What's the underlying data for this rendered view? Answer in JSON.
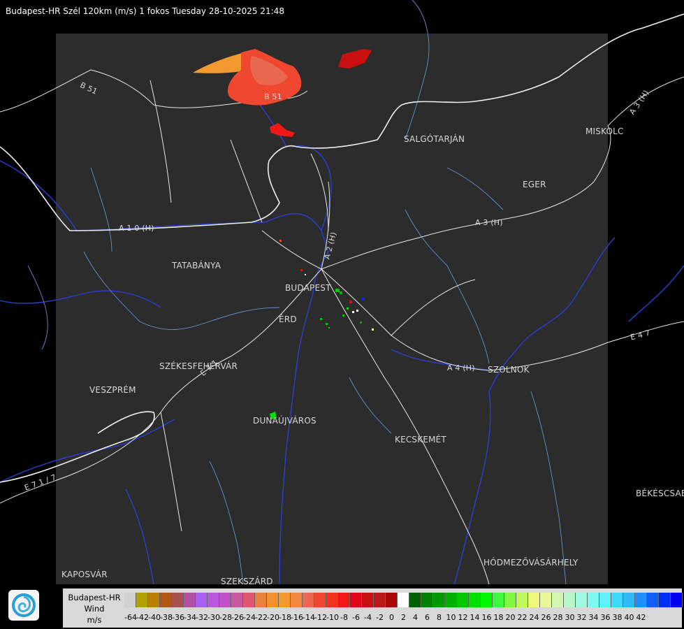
{
  "title": "Budapest-HR Szél 120km (m/s) 1 fokos Tuesday 28-10-2025 21:48",
  "cities": [
    {
      "name": "SALGÓTARJÁN"
    },
    {
      "name": "MISKOLC"
    },
    {
      "name": "EGER"
    },
    {
      "name": "TATABÁNYA"
    },
    {
      "name": "BUDAPEST"
    },
    {
      "name": "ÉRD"
    },
    {
      "name": "SZÉKESFEHÉRVÁR"
    },
    {
      "name": "VESZPRÉM"
    },
    {
      "name": "DUNAÚJVÁROS"
    },
    {
      "name": "SZOLNOK"
    },
    {
      "name": "KECSKEMÉT"
    },
    {
      "name": "BÉKÉSCSABA"
    },
    {
      "name": "HÓDMEZŐVÁSÁRHELY"
    },
    {
      "name": "KAPOSVÁR"
    },
    {
      "name": "SZEKSZÁRD"
    }
  ],
  "roads": [
    "B 51",
    "B 51",
    "A 3 (H)",
    "A 3 (H)",
    "A 1 0 (H)",
    "A 2 (H)",
    "A 4 (H)",
    "E 4 7",
    "E 7 1",
    "E 7 1 / 7"
  ],
  "legend": {
    "line1": "Budapest-HR",
    "line2": "Wind",
    "line3": "m/s",
    "colors": [
      "#d0d0d0",
      "#b0a000",
      "#b88000",
      "#b05818",
      "#a85050",
      "#b050a0",
      "#a860f0",
      "#b858e0",
      "#c050c8",
      "#c858a0",
      "#e05870",
      "#e88040",
      "#f09030",
      "#f49830",
      "#f08840",
      "#e86850",
      "#f04830",
      "#f43020",
      "#f01818",
      "#e00818",
      "#c81010",
      "#b81818",
      "#a80808",
      "#ffffff",
      "#006000",
      "#008000",
      "#009800",
      "#00b000",
      "#00c800",
      "#00e000",
      "#00f800",
      "#40f840",
      "#80f840",
      "#c0f860",
      "#f0f880",
      "#e8f898",
      "#d0f8b0",
      "#b8f8c8",
      "#a0f8e0",
      "#80f8f0",
      "#60f0f8",
      "#40d8f8",
      "#30b8f8",
      "#2090f8",
      "#1060f8",
      "#0030f8",
      "#0000f0"
    ],
    "ticks": [
      "-64",
      "-42",
      "-40",
      "-38",
      "-36",
      "-34",
      "-32",
      "-30",
      "-28",
      "-26",
      "-24",
      "-22",
      "-20",
      "-18",
      "-16",
      "-14",
      "-12",
      "-10",
      "-8",
      "-6",
      "-4",
      "-2",
      "0",
      "2",
      "4",
      "6",
      "8",
      "10",
      "12",
      "14",
      "16",
      "18",
      "20",
      "22",
      "24",
      "26",
      "28",
      "30",
      "32",
      "34",
      "36",
      "38",
      "40",
      "42"
    ]
  }
}
